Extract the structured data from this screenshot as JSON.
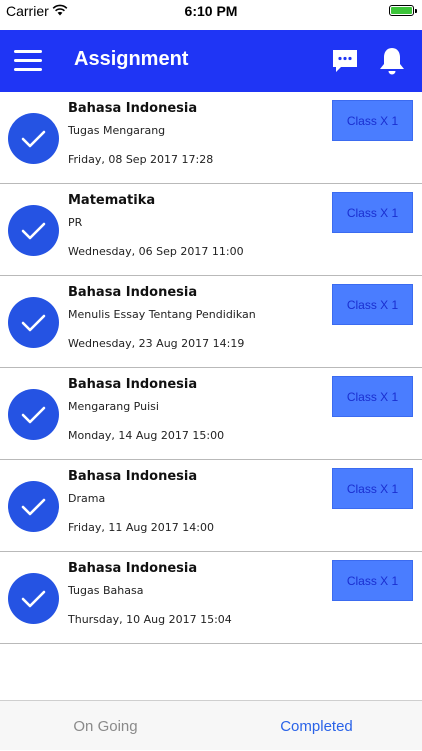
{
  "status_bar": {
    "carrier": "Carrier",
    "time": "6:10 PM"
  },
  "header": {
    "title": "Assignment",
    "icons": [
      "menu-icon",
      "chat-icon",
      "bell-icon"
    ]
  },
  "assignments": [
    {
      "subject": "Bahasa Indonesia",
      "description": "Tugas Mengarang",
      "date": "Friday, 08 Sep 2017 17:28",
      "class": "Class X 1"
    },
    {
      "subject": "Matematika",
      "description": "PR",
      "date": "Wednesday, 06 Sep 2017 11:00",
      "class": "Class X 1"
    },
    {
      "subject": "Bahasa Indonesia",
      "description": "Menulis Essay Tentang Pendidikan",
      "date": "Wednesday, 23 Aug 2017 14:19",
      "class": "Class X 1"
    },
    {
      "subject": "Bahasa Indonesia",
      "description": "Mengarang Puisi",
      "date": "Monday, 14 Aug 2017 15:00",
      "class": "Class X 1"
    },
    {
      "subject": "Bahasa Indonesia",
      "description": "Drama",
      "date": "Friday, 11 Aug 2017 14:00",
      "class": "Class X 1"
    },
    {
      "subject": "Bahasa Indonesia",
      "description": "Tugas Bahasa",
      "date": "Thursday, 10 Aug 2017 15:04",
      "class": "Class X 1"
    }
  ],
  "tabs": {
    "ongoing": "On Going",
    "completed": "Completed",
    "active": "completed"
  },
  "colors": {
    "header": "#1f35f5",
    "check_circle": "#2553e3",
    "class_button": "#4a7dff",
    "active_tab": "#2a63e8",
    "battery": "#3cc43a"
  }
}
